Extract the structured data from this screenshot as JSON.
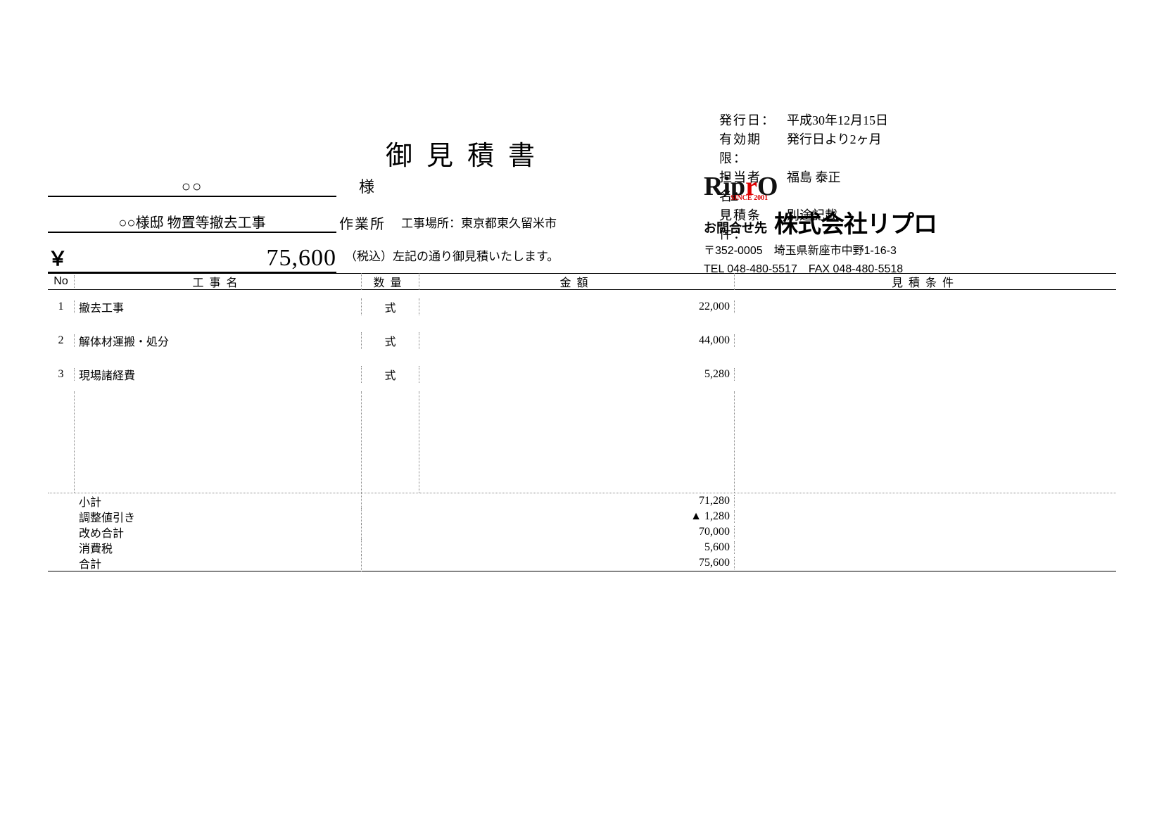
{
  "title": "御見積書",
  "header": {
    "issue_date_label": "発行日",
    "issue_date": "平成30年12月15日",
    "valid_label": "有効期限",
    "valid": "発行日より2ヶ月",
    "person_label": "担当者名",
    "person": "福島 泰正",
    "cond_label": "見積条件",
    "cond": "別途記載"
  },
  "client": {
    "name": "○○",
    "suffix": "様"
  },
  "work": {
    "name": "○○様邸 物置等撤去工事",
    "suffix": "作業所",
    "place": "工事場所：東京都東久留米市"
  },
  "total": {
    "yen": "￥",
    "amount": "75,600",
    "note": "（税込）左記の通り御見積いたします。"
  },
  "company": {
    "logo_text_1": "Rip",
    "logo_text_2": "r",
    "logo_text_3": "O",
    "since": "SINCE 2001",
    "contact_label": "お問合せ先",
    "name": "株式会社リプロ",
    "postal_addr": "〒352-0005　埼玉県新座市中野1-16-3",
    "tel_fax": "TEL 048-480-5517　FAX 048-480-5518"
  },
  "table": {
    "headers": {
      "no": "No",
      "name": "工事名",
      "qty": "数量",
      "amount": "金額",
      "cond": "見積条件"
    },
    "rows": [
      {
        "no": "1",
        "name": "撤去工事",
        "qty": "式",
        "amount": "22,000",
        "cond": ""
      },
      {
        "no": "2",
        "name": "解体材運搬・処分",
        "qty": "式",
        "amount": "44,000",
        "cond": ""
      },
      {
        "no": "3",
        "name": "現場諸経費",
        "qty": "式",
        "amount": "5,280",
        "cond": ""
      }
    ],
    "summary": [
      {
        "label": "小計",
        "amount": "71,280"
      },
      {
        "label": "調整値引き",
        "amount": "▲ 1,280"
      },
      {
        "label": "改め合計",
        "amount": "70,000"
      },
      {
        "label": "消費税",
        "amount": "5,600"
      },
      {
        "label": "合計",
        "amount": "75,600"
      }
    ]
  }
}
